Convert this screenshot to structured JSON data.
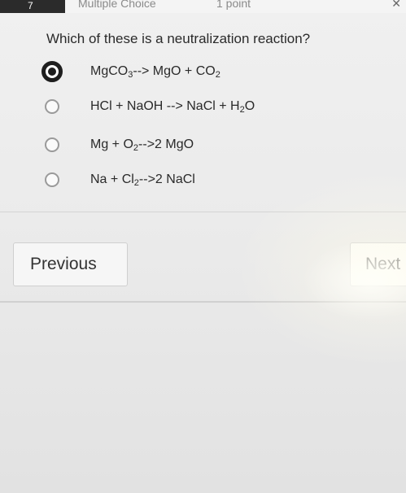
{
  "header": {
    "question_number": "7",
    "question_type": "Multiple Choice",
    "points": "1 point",
    "corner_icon": "expand-icon"
  },
  "question": {
    "text": "Which of these is a neutralization reaction?"
  },
  "options": [
    {
      "selected": true,
      "parts": [
        "MgCO",
        "3",
        "--> MgO + CO",
        "2"
      ]
    },
    {
      "selected": false,
      "parts": [
        "HCl + NaOH --> NaCl + H",
        "2",
        "O"
      ]
    },
    {
      "selected": false,
      "parts": [
        "Mg + O",
        "2",
        "-->2 MgO"
      ]
    },
    {
      "selected": false,
      "parts": [
        "Na + Cl",
        "2",
        "-->2 NaCl"
      ]
    }
  ],
  "navigation": {
    "previous_label": "Previous",
    "next_label": "Next"
  },
  "colors": {
    "selected_radio": "#1e1e1e",
    "unselected_radio_border": "#9a9a9a",
    "text": "#2a2a2a",
    "button_border": "#cfcfcf"
  }
}
